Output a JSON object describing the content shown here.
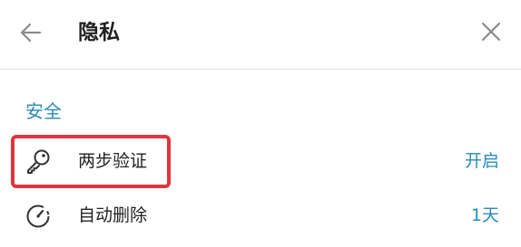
{
  "header": {
    "title": "隐私",
    "back_icon": "arrow-left-icon",
    "close_icon": "close-icon"
  },
  "section": {
    "title": "安全"
  },
  "rows": [
    {
      "icon": "key-icon",
      "label": "两步验证",
      "value": "开启",
      "highlighted": true
    },
    {
      "icon": "timer-icon",
      "label": "自动删除",
      "value": "1天"
    }
  ],
  "colors": {
    "accent": "#2a8ab8",
    "highlight": "#e0353b",
    "text": "#222222",
    "icon": "#888888"
  }
}
